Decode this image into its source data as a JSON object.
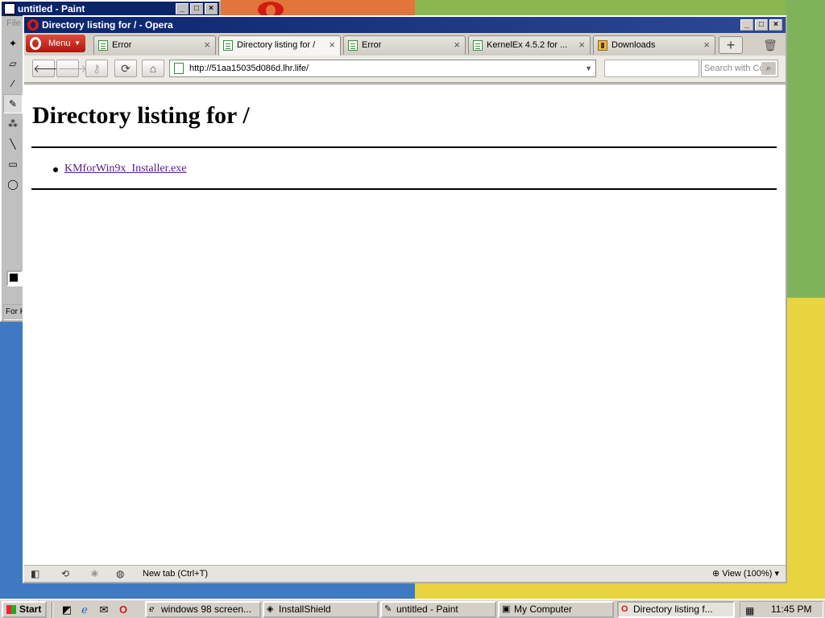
{
  "paint": {
    "title": "untitled - Paint",
    "menu_file": "File",
    "help_text": "For H"
  },
  "window": {
    "title": "Directory listing for / - Opera",
    "minimize": "_",
    "maximize": "□",
    "close": "×"
  },
  "menu_button": {
    "label": "Menu"
  },
  "tabs": [
    {
      "label": "Error",
      "icon": "page-icon",
      "active": false
    },
    {
      "label": "Directory listing for /",
      "icon": "page-icon",
      "active": true
    },
    {
      "label": "Error",
      "icon": "page-icon",
      "active": false
    },
    {
      "label": "KernelEx 4.5.2 for ...",
      "icon": "page-icon",
      "active": false
    },
    {
      "label": "Downloads",
      "icon": "downloads-icon",
      "active": false
    }
  ],
  "tab_close_glyph": "×",
  "newtab_glyph": "+",
  "nav": {
    "back": "🡐",
    "forward": "🡒",
    "key": "⚷",
    "reload": "⟳",
    "home": "⌂",
    "address": "http://51aa15035d086d.lhr.life/",
    "search_placeholder": "Search with Co",
    "search_button": "⌕"
  },
  "page": {
    "heading": "Directory listing for /",
    "files": [
      "KMforWin9x_Installer.exe"
    ]
  },
  "status": {
    "panel_icon": "◧",
    "sync_icon": "⟲",
    "share_icon": "⚛",
    "turbo_icon": "◍",
    "text": "New tab (Ctrl+T)",
    "zoom": "View (100%)",
    "zoom_icon": "⊕"
  },
  "taskbar": {
    "start": "Start",
    "tasks": [
      {
        "label": "windows 98 screen...",
        "icon": "ie-icon",
        "active": false
      },
      {
        "label": "InstallShield",
        "icon": "installshield-icon",
        "active": false
      },
      {
        "label": "untitled - Paint",
        "icon": "paint-icon",
        "active": false
      },
      {
        "label": "My Computer",
        "icon": "computer-icon",
        "active": false
      },
      {
        "label": "Directory listing f...",
        "icon": "opera-icon",
        "active": true
      }
    ],
    "clock": "11:45 PM"
  },
  "colors": {
    "title_bar": "#0a246a",
    "link_visited": "#551a8b",
    "menu_button": "#b0160c"
  }
}
